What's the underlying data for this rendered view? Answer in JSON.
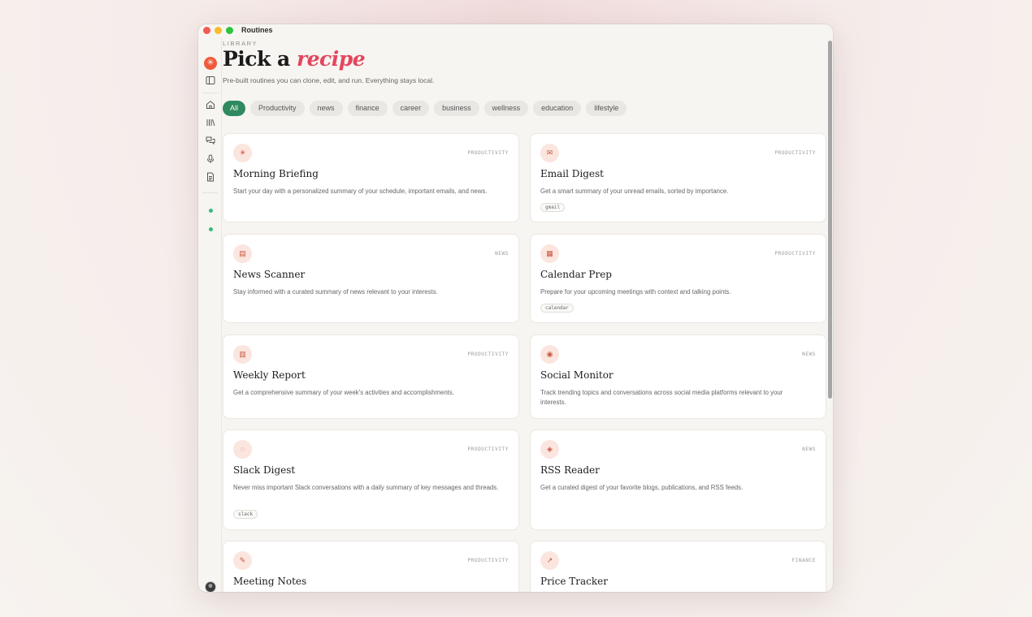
{
  "window": {
    "title": "Routines"
  },
  "sidebar": {
    "logo_icon": "sparkle-icon",
    "icons": [
      "panel-toggle-icon",
      "home-icon",
      "library-icon",
      "chat-icon",
      "microphone-icon",
      "document-icon"
    ],
    "status_color": "#37b97c"
  },
  "header": {
    "eyebrow": "LIBRARY",
    "title_prefix": "Pick a",
    "title_accent": "recipe",
    "subtitle": "Pre-built routines you can clone, edit, and run. Everything stays local."
  },
  "filters": {
    "active": "All",
    "items": [
      "All",
      "Productivity",
      "news",
      "finance",
      "career",
      "business",
      "wellness",
      "education",
      "lifestyle"
    ]
  },
  "cards": [
    {
      "icon": "☀",
      "icon_name": "sun-icon",
      "category": "PRODUCTIVITY",
      "title": "Morning Briefing",
      "desc": "Start your day with a personalized summary of your schedule, important emails, and news.",
      "tag": ""
    },
    {
      "icon": "✉",
      "icon_name": "envelope-icon",
      "category": "PRODUCTIVITY",
      "title": "Email Digest",
      "desc": "Get a smart summary of your unread emails, sorted by importance.",
      "tag": "gmail"
    },
    {
      "icon": "▤",
      "icon_name": "newspaper-icon",
      "category": "NEWS",
      "title": "News Scanner",
      "desc": "Stay informed with a curated summary of news relevant to your interests.",
      "tag": ""
    },
    {
      "icon": "▦",
      "icon_name": "calendar-icon",
      "category": "PRODUCTIVITY",
      "title": "Calendar Prep",
      "desc": "Prepare for your upcoming meetings with context and talking points.",
      "tag": "calendar"
    },
    {
      "icon": "▥",
      "icon_name": "bar-chart-icon",
      "category": "PRODUCTIVITY",
      "title": "Weekly Report",
      "desc": "Get a comprehensive summary of your week's activities and accomplishments.",
      "tag": ""
    },
    {
      "icon": "◉",
      "icon_name": "people-icon",
      "category": "NEWS",
      "title": "Social Monitor",
      "desc": "Track trending topics and conversations across social media platforms relevant to your interests.",
      "tag": ""
    },
    {
      "icon": "◌",
      "icon_name": "speech-bubble-icon",
      "category": "PRODUCTIVITY",
      "title": "Slack Digest",
      "desc": "Never miss important Slack conversations with a daily summary of key messages and threads.",
      "tag": "slack"
    },
    {
      "icon": "◈",
      "icon_name": "satellite-icon",
      "category": "NEWS",
      "title": "RSS Reader",
      "desc": "Get a curated digest of your favorite blogs, publications, and RSS feeds.",
      "tag": ""
    },
    {
      "icon": "✎",
      "icon_name": "memo-icon",
      "category": "PRODUCTIVITY",
      "title": "Meeting Notes",
      "desc": "",
      "tag": ""
    },
    {
      "icon": "↗",
      "icon_name": "trend-chart-icon",
      "category": "FINANCE",
      "title": "Price Tracker",
      "desc": "",
      "tag": ""
    }
  ]
}
